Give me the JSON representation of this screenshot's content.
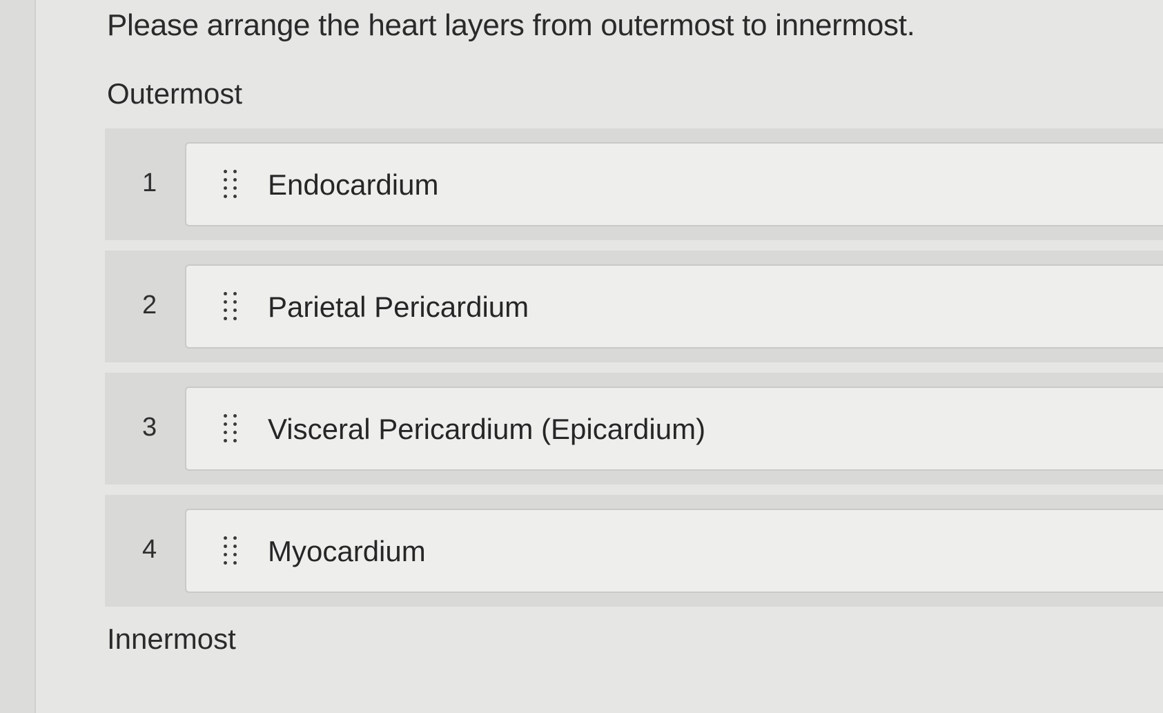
{
  "question": {
    "prompt": "Please arrange the heart layers from outermost to innermost."
  },
  "labels": {
    "top": "Outermost",
    "bottom": "Innermost"
  },
  "items": [
    {
      "number": "1",
      "label": "Endocardium"
    },
    {
      "number": "2",
      "label": "Parietal Pericardium"
    },
    {
      "number": "3",
      "label": "Visceral Pericardium (Epicardium)"
    },
    {
      "number": "4",
      "label": "Myocardium"
    }
  ],
  "icons": {
    "handle": "drag-handle-icon"
  },
  "colors": {
    "background": "#e6e6e4",
    "row_background": "#d9d9d7",
    "card_background": "#eeeeec",
    "text": "#2b2b2b"
  }
}
